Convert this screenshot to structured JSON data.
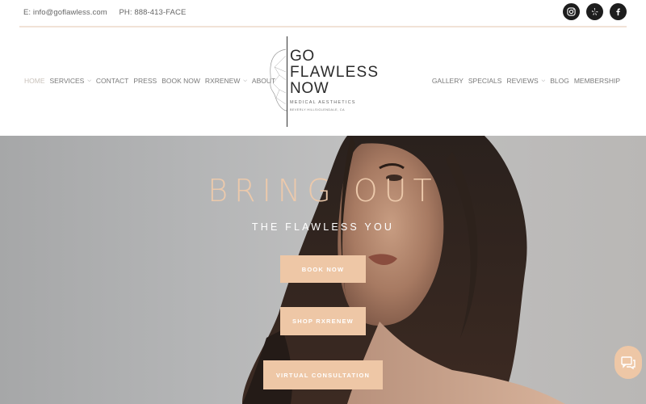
{
  "topbar": {
    "email": "E: info@goflawless.com",
    "phone": "PH: 888-413-FACE",
    "socials": [
      {
        "name": "instagram-icon"
      },
      {
        "name": "yelp-icon"
      },
      {
        "name": "facebook-icon"
      }
    ]
  },
  "nav": {
    "left": [
      {
        "label": "HOME",
        "active": true
      },
      {
        "label": "SERVICES",
        "dropdown": true
      },
      {
        "label": "CONTACT"
      },
      {
        "label": "PRESS"
      },
      {
        "label": "BOOK NOW"
      },
      {
        "label": "RXRENEW",
        "dropdown": true
      },
      {
        "label": "ABOUT"
      }
    ],
    "right": [
      {
        "label": "GALLERY"
      },
      {
        "label": "SPECIALS"
      },
      {
        "label": "REVIEWS",
        "dropdown": true
      },
      {
        "label": "BLOG"
      },
      {
        "label": "MEMBERSHIP"
      }
    ]
  },
  "logo": {
    "line1": "GO",
    "line2": "FLAWLESS",
    "line3": "NOW",
    "tagline": "MEDICAL AESTHETICS",
    "location": "BEVERLY HILLS/GLENDALE, CA"
  },
  "hero": {
    "headline": "BRING OUT",
    "subheadline": "THE FLAWLESS YOU",
    "book_label": "BOOK NOW",
    "shop_label": "SHOP RXRENEW",
    "virtual_label": "VIRTUAL CONSULTATION"
  },
  "colors": {
    "accent": "#eec7a6",
    "headline": "#ecc9ab",
    "social_bg": "#1d1d1d"
  }
}
